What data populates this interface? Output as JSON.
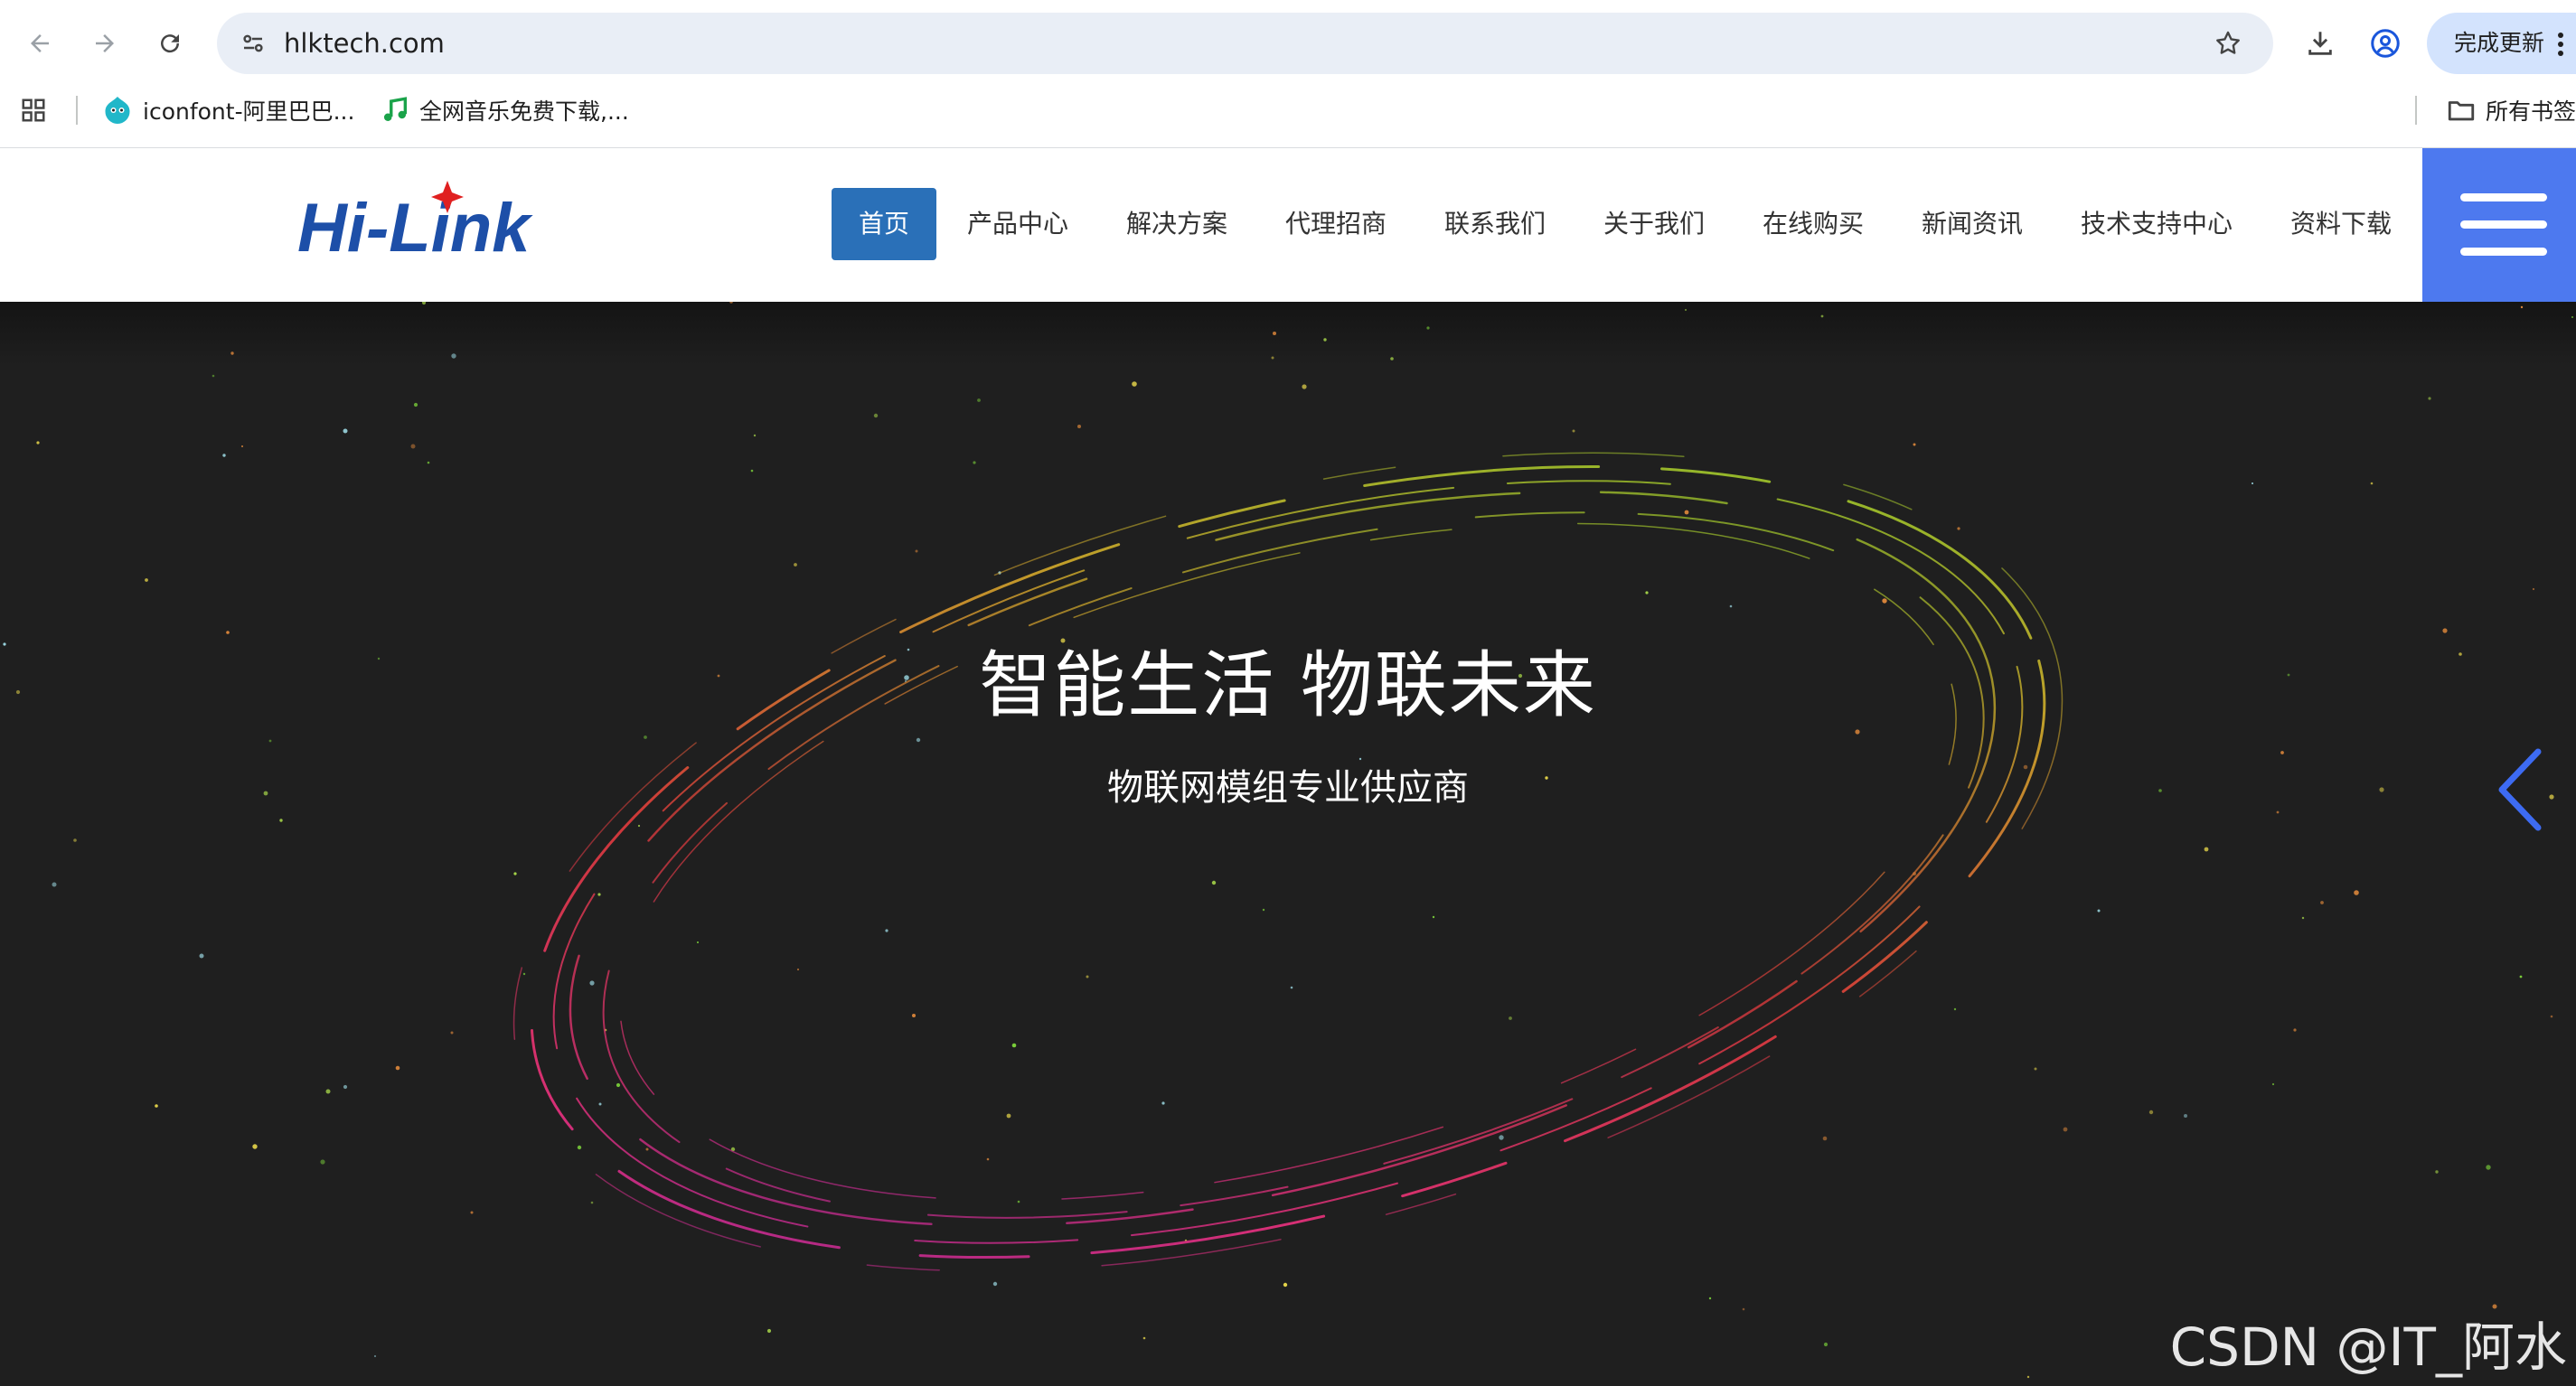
{
  "browser": {
    "url": "hlktech.com",
    "update_label": "完成更新",
    "bookmarks": [
      {
        "label": "iconfont-阿里巴巴...",
        "icon": "iconfont-favicon"
      },
      {
        "label": "全网音乐免费下载,...",
        "icon": "music-note-icon"
      }
    ],
    "all_bookmarks_label": "所有书签"
  },
  "site": {
    "logo_text": "Hi-Link",
    "menu": [
      "首页",
      "产品中心",
      "解决方案",
      "代理招商",
      "联系我们",
      "关于我们",
      "在线购买",
      "新闻资讯",
      "技术支持中心",
      "资料下载"
    ],
    "active_index": 0
  },
  "hero": {
    "title": "智能生活 物联未来",
    "subtitle": "物联网模组专业供应商"
  },
  "watermark": "CSDN @IT_阿水",
  "colors": {
    "nav_active": "#2a70b8",
    "hamburger_bg": "#4d79ef",
    "hero_bg": "#1f1f1f",
    "logo_blue": "#1d4fa8",
    "logo_red": "#e02020",
    "arrow": "#3d6bf2"
  }
}
